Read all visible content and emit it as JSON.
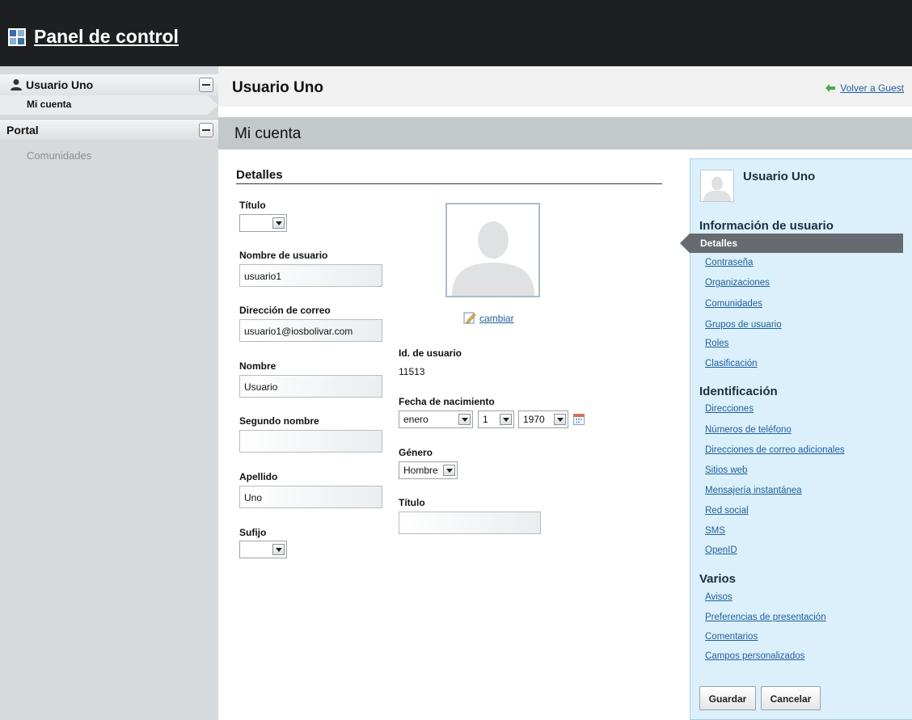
{
  "topbar": {
    "title": "Panel de control"
  },
  "sidebar": {
    "user_section": {
      "title": "Usuario Uno",
      "active_item": "Mi cuenta"
    },
    "portal_section": {
      "title": "Portal",
      "items": [
        "Comunidades"
      ]
    }
  },
  "header": {
    "title": "Usuario Uno",
    "back_link": "Volver a Guest"
  },
  "section": {
    "title": "Mi cuenta"
  },
  "form": {
    "heading": "Detalles",
    "titulo_label": "Título",
    "titulo_value": "",
    "username_label": "Nombre de usuario",
    "username_value": "usuario1",
    "email_label": "Dirección de correo",
    "email_value": "usuario1@iosbolivar.com",
    "nombre_label": "Nombre",
    "nombre_value": "Usuario",
    "segundo_label": "Segundo nombre",
    "segundo_value": "",
    "apellido_label": "Apellido",
    "apellido_value": "Uno",
    "sufijo_label": "Sufijo",
    "sufijo_value": "",
    "cambiar": "cambiar",
    "userid_label": "Id. de usuario",
    "userid_value": "11513",
    "birth_label": "Fecha de nacimiento",
    "birth_month": "enero",
    "birth_day": "1",
    "birth_year": "1970",
    "gender_label": "Género",
    "gender_value": "Hombre",
    "jobtitle_label": "Título",
    "jobtitle_value": ""
  },
  "right_panel": {
    "name": "Usuario Uno",
    "info_heading": "Información de usuario",
    "active_item": "Detalles",
    "info_links": [
      "Contraseña",
      "Organizaciones",
      "Comunidades",
      "Grupos de usuario",
      "Roles",
      "Clasificación"
    ],
    "ident_heading": "Identificación",
    "ident_links": [
      "Direcciones",
      "Números de teléfono",
      "Direcciones de correo adicionales",
      "Sitios web",
      "Mensajería instantánea",
      "Red social",
      "SMS",
      "OpenID"
    ],
    "varios_heading": "Varios",
    "varios_links": [
      "Avisos",
      "Preferencias de presentación",
      "Comentarios",
      "Campos personalizados"
    ],
    "save": "Guardar",
    "cancel": "Cancelar"
  },
  "colors": {
    "topbar": "#1d1f21",
    "sidebar": "#d7dadd",
    "section_bar": "#c3c8ca",
    "right_panel": "#dcf0fb",
    "link": "#1f5f9e",
    "active_item": "#666b70"
  },
  "icons": {
    "logo": "control-panel-logo-icon",
    "user": "person-icon",
    "back": "green-arrow-left-icon",
    "edit": "pencil-icon",
    "calendar": "calendar-icon"
  }
}
